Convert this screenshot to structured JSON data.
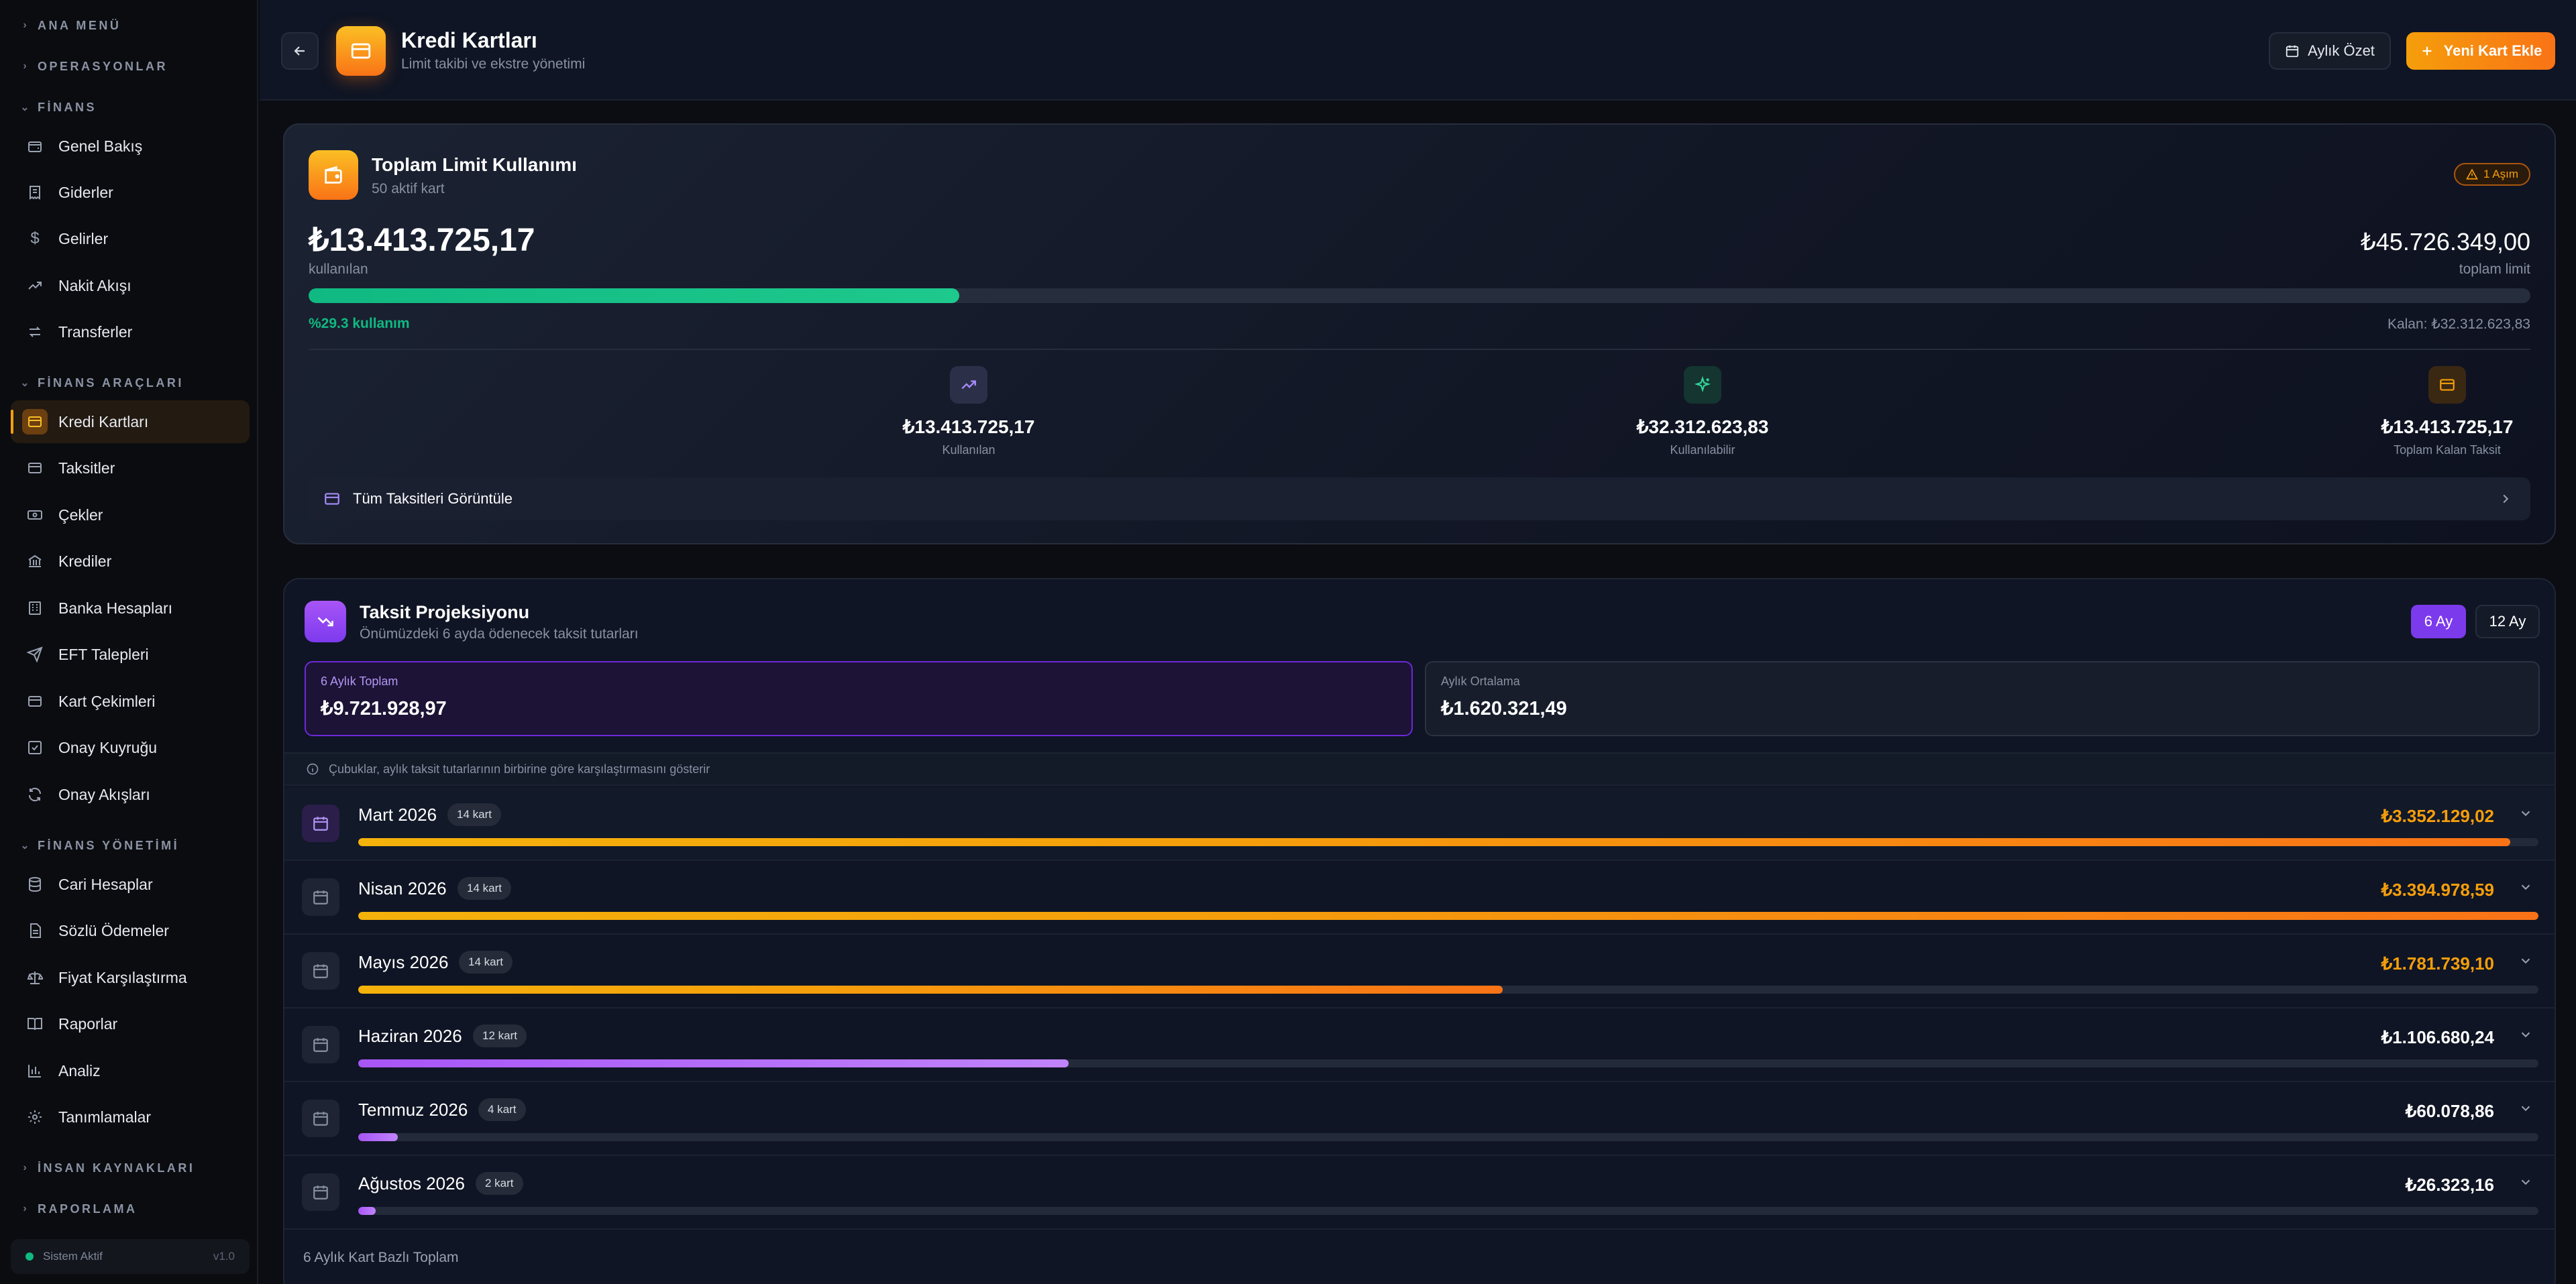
{
  "sidebar": {
    "sections": {
      "main_menu": "ANA MENÜ",
      "operations": "OPERASYONLAR",
      "finance": "FİNANS",
      "finance_tools": "FİNANS ARAÇLARI",
      "finance_mgmt": "FİNANS YÖNETİMİ",
      "hr": "İNSAN KAYNAKLARI",
      "reporting": "RAPORLAMA"
    },
    "items": [
      {
        "label": "Genel Bakış",
        "icon": "wallet-icon"
      },
      {
        "label": "Giderler",
        "icon": "receipt-icon"
      },
      {
        "label": "Gelirler",
        "icon": "dollar-icon"
      },
      {
        "label": "Nakit Akışı",
        "icon": "trend-up-icon"
      },
      {
        "label": "Transferler",
        "icon": "arrows-swap-icon"
      },
      {
        "label": "Kredi Kartları",
        "icon": "credit-card-icon",
        "active": true
      },
      {
        "label": "Taksitler",
        "icon": "card-icon"
      },
      {
        "label": "Çekler",
        "icon": "banknote-icon"
      },
      {
        "label": "Krediler",
        "icon": "bank-icon"
      },
      {
        "label": "Banka Hesapları",
        "icon": "building-icon"
      },
      {
        "label": "EFT Talepleri",
        "icon": "send-icon"
      },
      {
        "label": "Kart Çekimleri",
        "icon": "card-icon"
      },
      {
        "label": "Onay Kuyruğu",
        "icon": "check-square-icon"
      },
      {
        "label": "Onay Akışları",
        "icon": "refresh-icon"
      },
      {
        "label": "Cari Hesaplar",
        "icon": "database-icon"
      },
      {
        "label": "Sözlü Ödemeler",
        "icon": "document-icon"
      },
      {
        "label": "Fiyat Karşılaştırma",
        "icon": "scale-icon"
      },
      {
        "label": "Raporlar",
        "icon": "book-icon"
      },
      {
        "label": "Analiz",
        "icon": "bar-chart-icon"
      },
      {
        "label": "Tanımlamalar",
        "icon": "gear-icon"
      }
    ],
    "status": {
      "text": "Sistem Aktif",
      "version": "v1.0",
      "color": "#10b981"
    }
  },
  "header": {
    "title": "Kredi Kartları",
    "subtitle": "Limit takibi ve ekstre yönetimi",
    "summary_button": "Aylık Özet",
    "new_card_button": "Yeni Kart Ekle",
    "accent": "#f97316"
  },
  "limit_card": {
    "title": "Toplam Limit Kullanımı",
    "subtitle": "50 aktif kart",
    "over_badge": "1 Aşım",
    "used_amount": "₺13.413.725,17",
    "used_label": "kullanılan",
    "total_amount": "₺45.726.349,00",
    "total_label": "toplam limit",
    "usage_percent": 29.3,
    "usage_text": "%29.3 kullanım",
    "remaining_text": "Kalan: ₺32.312.623,83",
    "stats": [
      {
        "value": "₺13.413.725,17",
        "label": "Kullanılan",
        "icon": "trend-up-icon"
      },
      {
        "value": "₺32.312.623,83",
        "label": "Kullanılabilir",
        "icon": "sparkle-icon"
      },
      {
        "value": "₺13.413.725,17",
        "label": "Toplam Kalan Taksit",
        "icon": "credit-card-icon"
      }
    ],
    "all_installments": "Tüm Taksitleri Görüntüle"
  },
  "projection": {
    "title": "Taksit Projeksiyonu",
    "subtitle": "Önümüzdeki 6 ayda ödenecek taksit tutarları",
    "tabs": [
      "6 Ay",
      "12 Ay"
    ],
    "selected_tab": "6 Ay",
    "six_month_total_label": "6 Aylık Toplam",
    "six_month_total": "₺9.721.928,97",
    "monthly_avg_label": "Aylık Ortalama",
    "monthly_avg": "₺1.620.321,49",
    "info": "Çubuklar, aylık taksit tutarlarının birbirine göre karşılaştırmasını gösterir",
    "months": [
      {
        "name": "Mart 2026",
        "cards": "14 kart",
        "amount": "₺3.352.129,02",
        "ratio": 0.987,
        "tone": "orange"
      },
      {
        "name": "Nisan 2026",
        "cards": "14 kart",
        "amount": "₺3.394.978,59",
        "ratio": 1.0,
        "tone": "orange"
      },
      {
        "name": "Mayıs 2026",
        "cards": "14 kart",
        "amount": "₺1.781.739,10",
        "ratio": 0.525,
        "tone": "orange"
      },
      {
        "name": "Haziran 2026",
        "cards": "12 kart",
        "amount": "₺1.106.680,24",
        "ratio": 0.326,
        "tone": "purple"
      },
      {
        "name": "Temmuz 2026",
        "cards": "4 kart",
        "amount": "₺60.078,86",
        "ratio": 0.018,
        "tone": "purple"
      },
      {
        "name": "Ağustos 2026",
        "cards": "2 kart",
        "amount": "₺26.323,16",
        "ratio": 0.008,
        "tone": "purple"
      }
    ],
    "footer": "6 Aylık Kart Bazlı Toplam"
  }
}
